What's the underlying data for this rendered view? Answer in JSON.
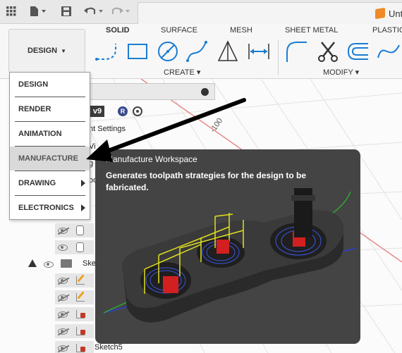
{
  "topbar": {
    "doc_title": "Unt",
    "icons": [
      "grid-icon",
      "file-icon",
      "save-icon",
      "undo-icon",
      "redo-icon"
    ]
  },
  "ribbon": {
    "workspace_button": "DESIGN",
    "tabs": [
      "SOLID",
      "SURFACE",
      "MESH",
      "SHEET METAL",
      "PLASTIC"
    ],
    "create_label": "CREATE",
    "modify_label": "MODIFY"
  },
  "browser": {
    "component_name": "ed v9",
    "badge": "R",
    "rows": [
      {
        "label": "nt Settings"
      },
      {
        "label": "Vi"
      },
      {
        "label": "g"
      },
      {
        "label": "oo"
      }
    ],
    "sketch_label": "Ske",
    "bottom_sketch": "Sketch5"
  },
  "menu": {
    "items": [
      {
        "label": "DESIGN",
        "submenu": false
      },
      {
        "label": "RENDER",
        "submenu": false
      },
      {
        "label": "ANIMATION",
        "submenu": false
      },
      {
        "label": "MANUFACTURE",
        "submenu": false,
        "highlighted": true
      },
      {
        "label": "DRAWING",
        "submenu": true
      },
      {
        "label": "ELECTRONICS",
        "submenu": true
      }
    ]
  },
  "viewport": {
    "axis_label": "-100"
  },
  "tooltip": {
    "title": "Manufacture Workspace",
    "description": "Generates toolpath strategies for the design to be fabricated."
  },
  "colors": {
    "accent": "#1a7dd4",
    "tooltip_bg": "#444444",
    "axis_red": "#e04040"
  }
}
